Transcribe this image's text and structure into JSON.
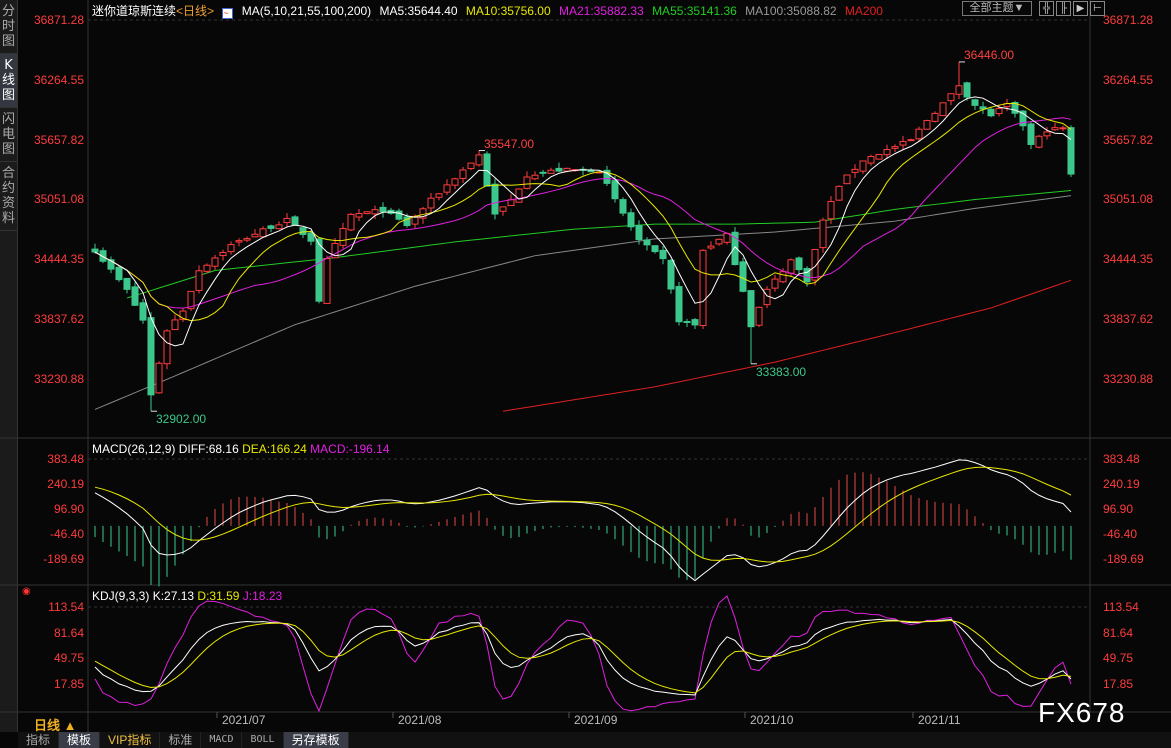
{
  "sidebar": {
    "tabs": [
      "分时图",
      "K线图",
      "闪电图",
      "合约资料"
    ],
    "active": 1
  },
  "legend": {
    "title": "迷你道琼斯连续",
    "period": "<日线>",
    "ma_params": "MA(5,10,21,55,100,200)",
    "ma5": "MA5:35644.40",
    "ma10": "MA10:35756.00",
    "ma21": "MA21:35882.33",
    "ma55": "MA55:35141.36",
    "ma100": "MA100:35088.82",
    "ma200": "MA200"
  },
  "toolbar": {
    "theme_label": "全部主题▼",
    "icons": [
      "crosshair-icon",
      "zoom-in-icon",
      "step-forward-icon",
      "move-right-icon"
    ],
    "icon_glyphs": [
      "╬",
      "╟",
      "▶",
      "⊢"
    ]
  },
  "price_axis": [
    "36871.28",
    "36264.55",
    "35657.82",
    "35051.08",
    "34444.35",
    "33837.62",
    "33230.88"
  ],
  "macd": {
    "label": "MACD(26,12,9)",
    "diff": "DIFF:68.16",
    "dea": "DEA:166.24",
    "macd": "MACD:-196.14",
    "axis": [
      "383.48",
      "240.19",
      "96.90",
      "-46.40",
      "-189.69"
    ]
  },
  "kdj": {
    "label": "KDJ(9,3,3)",
    "k": "K:27.13",
    "d": "D:31.59",
    "j": "J:18.23",
    "axis": [
      "113.54",
      "81.64",
      "49.75",
      "17.85"
    ]
  },
  "dates": [
    "2021/07",
    "2021/08",
    "2021/09",
    "2021/10",
    "2021/11"
  ],
  "period_selector": "日线 ▲",
  "bottom_tabs": [
    "指标",
    "模板",
    "VIP指标",
    "标准",
    "MACD",
    "BOLL",
    "另存模板"
  ],
  "watermark": "FX678",
  "colors": {
    "up": "#ff3c3c",
    "down": "#3cc88c",
    "ma5": "#ffffff",
    "ma10": "#e8e800",
    "ma21": "#e020e0",
    "ma55": "#22cc22",
    "ma100": "#888888",
    "ma200": "#e02020"
  },
  "chart_data": {
    "type": "candlestick",
    "bars": 123,
    "close_keypoints": [
      [
        0,
        34537
      ],
      [
        4,
        34130
      ],
      [
        6,
        33826
      ],
      [
        7,
        33065
      ],
      [
        9,
        33725
      ],
      [
        11,
        33927
      ],
      [
        13,
        34333
      ],
      [
        17,
        34587
      ],
      [
        21,
        34740
      ],
      [
        24,
        34841
      ],
      [
        27,
        34638
      ],
      [
        28,
        34029
      ],
      [
        29,
        34435
      ],
      [
        32,
        34892
      ],
      [
        36,
        34943
      ],
      [
        39,
        34790
      ],
      [
        42,
        35044
      ],
      [
        46,
        35349
      ],
      [
        48,
        35501
      ],
      [
        50,
        34892
      ],
      [
        52,
        35044
      ],
      [
        54,
        35298
      ],
      [
        58,
        35349
      ],
      [
        63,
        35349
      ],
      [
        65,
        35044
      ],
      [
        68,
        34638
      ],
      [
        71,
        34435
      ],
      [
        73,
        33826
      ],
      [
        75,
        33775
      ],
      [
        76,
        34537
      ],
      [
        79,
        34689
      ],
      [
        81,
        34130
      ],
      [
        82,
        33775
      ],
      [
        84,
        34130
      ],
      [
        87,
        34435
      ],
      [
        89,
        34232
      ],
      [
        91,
        34841
      ],
      [
        93,
        35196
      ],
      [
        96,
        35450
      ],
      [
        99,
        35552
      ],
      [
        102,
        35653
      ],
      [
        104,
        35856
      ],
      [
        107,
        36110
      ],
      [
        108,
        36211
      ],
      [
        110,
        36008
      ],
      [
        112,
        35907
      ],
      [
        114,
        36008
      ],
      [
        116,
        35805
      ],
      [
        117,
        35602
      ],
      [
        119,
        35755
      ],
      [
        121,
        35775
      ],
      [
        122,
        35298
      ]
    ],
    "ma55_keypoints": [
      [
        4,
        34050
      ],
      [
        15,
        34330
      ],
      [
        30,
        34460
      ],
      [
        45,
        34620
      ],
      [
        60,
        34750
      ],
      [
        70,
        34800
      ],
      [
        80,
        34800
      ],
      [
        90,
        34820
      ],
      [
        100,
        34950
      ],
      [
        110,
        35050
      ],
      [
        122,
        35141
      ]
    ],
    "ma100_keypoints": [
      [
        0,
        32920
      ],
      [
        10,
        33260
      ],
      [
        25,
        33780
      ],
      [
        40,
        34170
      ],
      [
        55,
        34480
      ],
      [
        70,
        34650
      ],
      [
        85,
        34720
      ],
      [
        100,
        34830
      ],
      [
        110,
        34960
      ],
      [
        122,
        35089
      ]
    ],
    "ma200_keypoints": [
      [
        51,
        32902
      ],
      [
        70,
        33150
      ],
      [
        85,
        33400
      ],
      [
        100,
        33700
      ],
      [
        112,
        33950
      ],
      [
        122,
        34230
      ]
    ],
    "annotations": [
      {
        "bar": 7,
        "value": "32902.00",
        "kind": "low"
      },
      {
        "bar": 48,
        "value": "35547.00",
        "kind": "high"
      },
      {
        "bar": 82,
        "value": "33383.00",
        "kind": "low"
      },
      {
        "bar": 108,
        "value": "36446.00",
        "kind": "high"
      }
    ],
    "date_bars": [
      19,
      41,
      63,
      85,
      106
    ],
    "ylim": [
      32902,
      36871.28
    ]
  }
}
